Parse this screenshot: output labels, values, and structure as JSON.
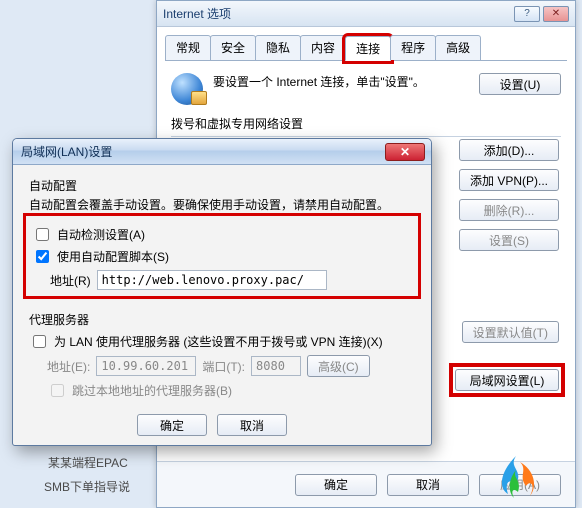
{
  "parent": {
    "title": "Internet 选项",
    "tabs": [
      "常规",
      "安全",
      "隐私",
      "内容",
      "连接",
      "程序",
      "高级"
    ],
    "active_tab_index": 4,
    "intro_text": "要设置一个 Internet 连接，单击\"设置\"。",
    "setup_btn": "设置(U)",
    "dialup_label": "拨号和虚拟专用网络设置",
    "side_buttons": {
      "add": "添加(D)...",
      "add_vpn": "添加 VPN(P)...",
      "remove": "删除(R)...",
      "settings": "设置(S)"
    },
    "defaults_btn": "设置默认值(T)",
    "lan_btn": "局域网设置(L)",
    "footer": {
      "ok": "确定",
      "cancel": "取消",
      "apply": "应用(A)"
    }
  },
  "child": {
    "title": "局域网(LAN)设置",
    "auto": {
      "legend": "自动配置",
      "desc": "自动配置会覆盖手动设置。要确保使用手动设置，请禁用自动配置。",
      "detect_label": "自动检测设置(A)",
      "detect_checked": false,
      "script_label": "使用自动配置脚本(S)",
      "script_checked": true,
      "addr_label": "地址(R)",
      "addr_value": "http://web.lenovo.proxy.pac/"
    },
    "proxy": {
      "legend": "代理服务器",
      "use_label": "为 LAN 使用代理服务器 (这些设置不用于拨号或 VPN 连接)(X)",
      "use_checked": false,
      "addr_label": "地址(E):",
      "addr_value": "10.99.60.201",
      "port_label": "端口(T):",
      "port_value": "8080",
      "advanced": "高级(C)",
      "bypass_label": "跳过本地地址的代理服务器(B)"
    },
    "footer": {
      "ok": "确定",
      "cancel": "取消"
    }
  },
  "stray": {
    "line1": "某某端程EPAC",
    "line2": "SMB下单指导说"
  }
}
